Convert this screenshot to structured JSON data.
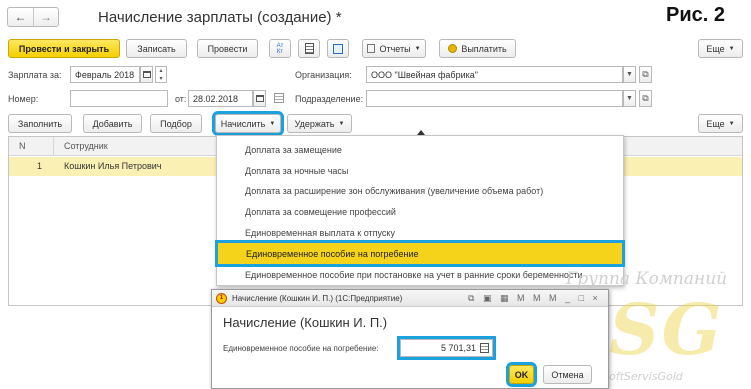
{
  "window": {
    "title": "Начисление зарплаты (создание) *",
    "figure_label": "Рис. 2"
  },
  "nav": {
    "back_glyph": "←",
    "forward_glyph": "→"
  },
  "toolbar": {
    "post_close": "Провести и закрыть",
    "write": "Записать",
    "post": "Провести",
    "reports": "Отчеты",
    "pay": "Выплатить",
    "more": "Еще"
  },
  "form": {
    "salary_label": "Зарплата за:",
    "salary_value": "Февраль 2018",
    "organization_label": "Организация:",
    "organization_value": "ООО \"Швейная фабрика\"",
    "number_label": "Номер:",
    "number_value": "",
    "date_label": "от:",
    "date_value": "28.02.2018",
    "division_label": "Подразделение:",
    "division_value": ""
  },
  "tabletoolbar": {
    "fill": "Заполнить",
    "add": "Добавить",
    "select": "Подбор",
    "accrue": "Начислить",
    "deduct": "Удержать",
    "more": "Еще"
  },
  "table": {
    "columns": [
      "N",
      "Сотрудник"
    ],
    "rows": [
      {
        "n": "1",
        "employee": "Кошкин Илья Петрович"
      }
    ]
  },
  "menu": {
    "items": [
      "Доплата за замещение",
      "Доплата за ночные часы",
      "Доплата за расширение зон обслуживания (увеличение объема работ)",
      "Доплата за совмещение профессий",
      "Единовременная выплата к отпуску",
      "Единовременное пособие на погребение",
      "Единовременное пособие при постановке на учет в ранние сроки беременности"
    ],
    "selected_index": 5
  },
  "dialog": {
    "title": "Начисление (Кошкин И. П.) (1С:Предприятие)",
    "heading": "Начисление (Кошкин И. П.)",
    "field_label": "Единовременное пособие на погребение:",
    "field_value": "5 701,31",
    "ok": "OK",
    "cancel": "Отмена"
  },
  "watermark": {
    "top": "Группа Компаний",
    "logo": "SSG",
    "bottom": "SoftServisGold"
  },
  "colors": {
    "accent_blue": "#1ba1dd",
    "primary_yellow": "#f5d31b",
    "selected_row": "#fbf0b3",
    "menu_selected": "#f5d31b"
  }
}
